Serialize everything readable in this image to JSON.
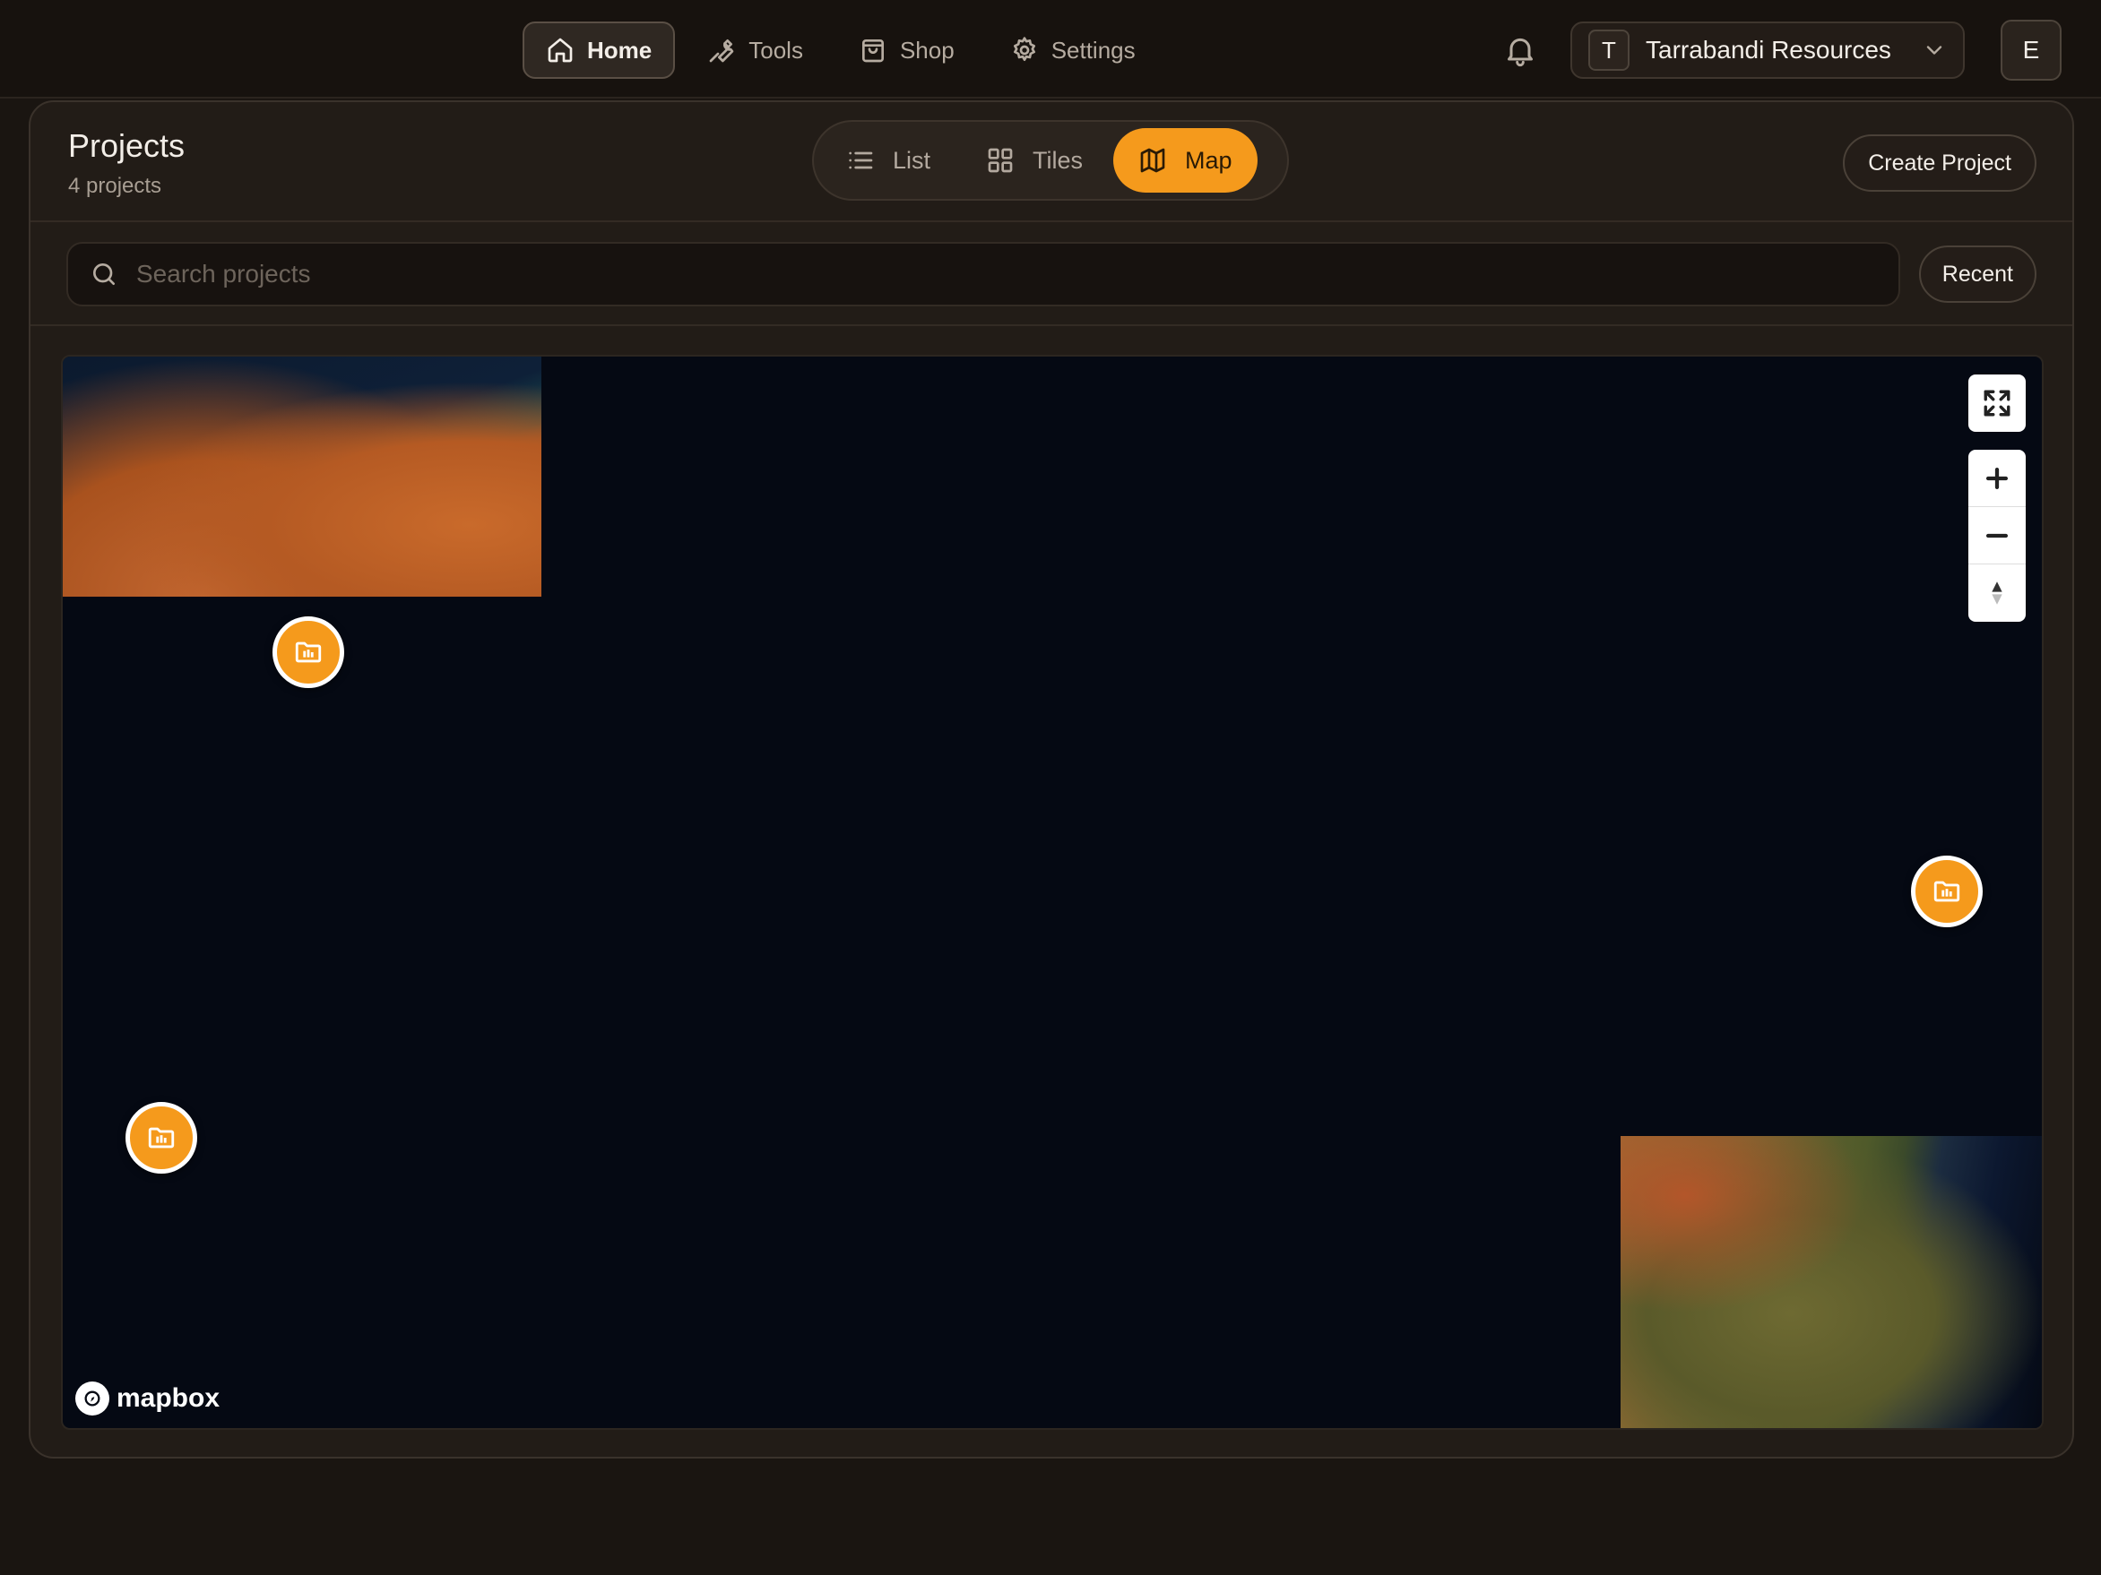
{
  "nav": {
    "items": [
      {
        "label": "Home",
        "icon": "home-icon",
        "active": true
      },
      {
        "label": "Tools",
        "icon": "wrench-icon",
        "active": false
      },
      {
        "label": "Shop",
        "icon": "shopping-bag-icon",
        "active": false
      },
      {
        "label": "Settings",
        "icon": "gear-icon",
        "active": false
      }
    ]
  },
  "org": {
    "badge": "T",
    "name": "Tarrabandi Resources"
  },
  "user": {
    "avatar_initial": "E"
  },
  "page": {
    "title": "Projects",
    "subtitle": "4 projects"
  },
  "view_switch": {
    "options": [
      {
        "label": "List",
        "icon": "list-icon"
      },
      {
        "label": "Tiles",
        "icon": "grid-icon"
      },
      {
        "label": "Map",
        "icon": "map-icon"
      }
    ],
    "selected": "Map"
  },
  "actions": {
    "create_label": "Create Project",
    "sort_label": "Recent"
  },
  "search": {
    "placeholder": "Search projects",
    "value": ""
  },
  "map": {
    "attribution": "mapbox",
    "markers": [
      {
        "icon": "project-folder-icon"
      },
      {
        "icon": "project-folder-icon"
      },
      {
        "icon": "project-folder-icon"
      }
    ],
    "controls": [
      "fullscreen-icon",
      "zoom-in-icon",
      "zoom-out-icon",
      "compass-icon"
    ]
  },
  "colors": {
    "accent": "#f59a1c",
    "background": "#1a1511",
    "panel": "#221c17",
    "map_ocean": "#050913"
  }
}
